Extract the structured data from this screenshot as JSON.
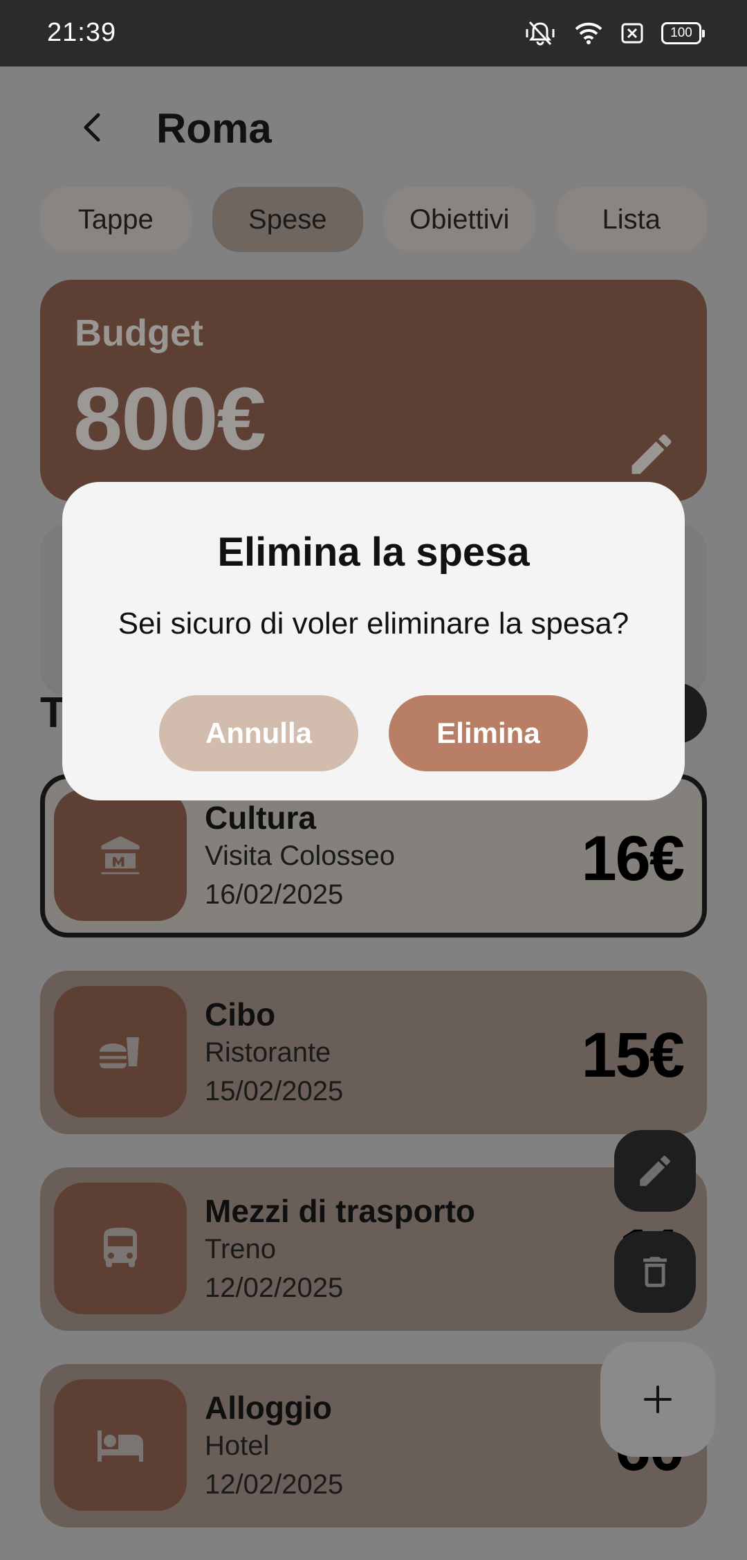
{
  "status_bar": {
    "time": "21:39",
    "battery": "100",
    "icons": [
      "mute-vibrate-icon",
      "wifi-icon",
      "no-sim-icon",
      "battery-icon"
    ]
  },
  "header": {
    "title": "Roma",
    "back_icon": "back-arrow-icon"
  },
  "tabs": [
    {
      "label": "Tappe",
      "active": false
    },
    {
      "label": "Spese",
      "active": true
    },
    {
      "label": "Obiettivi",
      "active": false
    },
    {
      "label": "Lista",
      "active": false
    }
  ],
  "budget": {
    "label": "Budget",
    "amount": "800€",
    "edit_icon": "pencil-icon"
  },
  "section": {
    "title": "T"
  },
  "expenses": [
    {
      "category": "Cultura",
      "description": "Visita Colosseo",
      "date": "16/02/2025",
      "amount": "16€",
      "icon": "museum-icon",
      "selected": true
    },
    {
      "category": "Cibo",
      "description": "Ristorante",
      "date": "15/02/2025",
      "amount": "15€",
      "icon": "fastfood-icon",
      "selected": false
    },
    {
      "category": "Mezzi di trasporto",
      "description": "Treno",
      "date": "12/02/2025",
      "amount": "11",
      "icon": "bus-icon",
      "selected": false
    },
    {
      "category": "Alloggio",
      "description": "Hotel",
      "date": "12/02/2025",
      "amount": "60",
      "icon": "bed-icon",
      "selected": false
    }
  ],
  "fabs": {
    "edit_icon": "pencil-icon",
    "delete_icon": "trash-icon",
    "add_icon": "plus-icon"
  },
  "dialog": {
    "title": "Elimina la spesa",
    "message": "Sei sicuro di voler eliminare la spesa?",
    "cancel_label": "Annulla",
    "confirm_label": "Elimina"
  },
  "colors": {
    "brand_brown": "#5d4033",
    "dialog_confirm": "#b87f66",
    "dialog_cancel": "#d2bcad",
    "scrim": "#818181"
  }
}
